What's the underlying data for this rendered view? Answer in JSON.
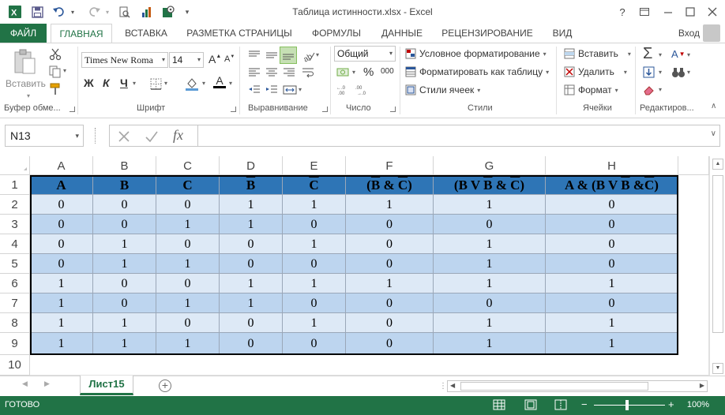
{
  "titlebar": {
    "title": "Таблица истинности.xlsx - Excel",
    "help": "?"
  },
  "tabs": {
    "file": "ФАЙЛ",
    "items": [
      "ГЛАВНАЯ",
      "ВСТАВКА",
      "РАЗМЕТКА СТРАНИЦЫ",
      "ФОРМУЛЫ",
      "ДАННЫЕ",
      "РЕЦЕНЗИРОВАНИЕ",
      "ВИД"
    ],
    "login": "Вход"
  },
  "ribbon": {
    "clipboard": {
      "paste": "Вставить",
      "label": "Буфер обме..."
    },
    "font": {
      "name": "Times New Roma",
      "size": "14",
      "bold": "Ж",
      "italic": "К",
      "underline": "Ч",
      "grow": "A",
      "shrink": "A",
      "color_letter": "A",
      "label": "Шрифт"
    },
    "alignment": {
      "label": "Выравнивание"
    },
    "number": {
      "format": "Общий",
      "percent": "%",
      "thousands": "000",
      "label": "Число"
    },
    "styles": {
      "conditional": "Условное форматирование",
      "as_table": "Форматировать как таблицу",
      "cell_styles": "Стили ячеек",
      "label": "Стили"
    },
    "cells": {
      "insert": "Вставить",
      "delete": "Удалить",
      "format": "Формат",
      "label": "Ячейки"
    },
    "editing": {
      "sum": "Σ",
      "sort": "А",
      "label": "Редактиров..."
    }
  },
  "formula_bar": {
    "name_box": "N13",
    "fx": "fx",
    "value": ""
  },
  "grid": {
    "col_letters": [
      "A",
      "B",
      "C",
      "D",
      "E",
      "F",
      "G",
      "H"
    ],
    "row_numbers": [
      "1",
      "2",
      "3",
      "4",
      "5",
      "6",
      "7",
      "8",
      "9",
      "10"
    ],
    "headers": {
      "a": "A",
      "b": "B",
      "c": "C",
      "d": "B",
      "e": "C",
      "f_open": "(",
      "f_b": "B",
      "f_mid": " & ",
      "f_c": "C",
      "f_close": ")",
      "g_open": "(B V ",
      "g_b": "B",
      "g_mid": " & ",
      "g_c": "C",
      "g_close": ")",
      "h_open": "A & (B V ",
      "h_b": "B",
      "h_mid": " &",
      "h_c": "C",
      "h_close": ")"
    },
    "rows": [
      [
        "0",
        "0",
        "0",
        "1",
        "1",
        "1",
        "1",
        "0"
      ],
      [
        "0",
        "0",
        "1",
        "1",
        "0",
        "0",
        "0",
        "0"
      ],
      [
        "0",
        "1",
        "0",
        "0",
        "1",
        "0",
        "1",
        "0"
      ],
      [
        "0",
        "1",
        "1",
        "0",
        "0",
        "0",
        "1",
        "0"
      ],
      [
        "1",
        "0",
        "0",
        "1",
        "1",
        "1",
        "1",
        "1"
      ],
      [
        "1",
        "0",
        "1",
        "1",
        "0",
        "0",
        "0",
        "0"
      ],
      [
        "1",
        "1",
        "0",
        "0",
        "1",
        "0",
        "1",
        "1"
      ],
      [
        "1",
        "1",
        "1",
        "0",
        "0",
        "0",
        "1",
        "1"
      ]
    ]
  },
  "sheets": {
    "active": "Лист15",
    "add": "+"
  },
  "status": {
    "ready": "ГОТОВО",
    "zoom": "100%"
  },
  "colors": {
    "excel_green": "#217346",
    "header_blue": "#2e75b6",
    "band_light": "#dde9f6",
    "band_dark": "#bdd5ef"
  }
}
